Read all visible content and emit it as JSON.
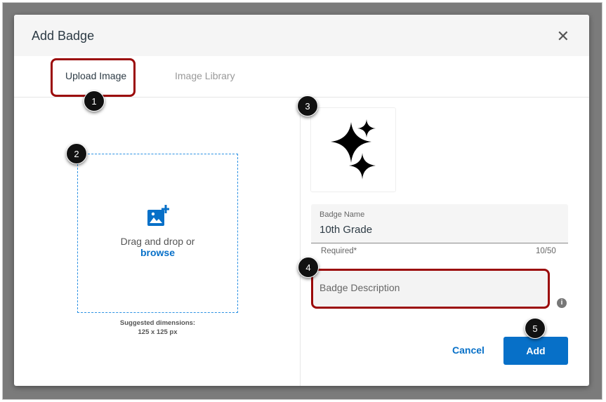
{
  "dialog": {
    "title": "Add Badge",
    "close_label": "✕"
  },
  "tabs": [
    {
      "label": "Upload Image"
    },
    {
      "label": "Image Library"
    }
  ],
  "dropzone": {
    "text": "Drag and drop or",
    "link": "browse",
    "suggested": "Suggested dimensions:",
    "dimensions": "125 x 125 px"
  },
  "badge_name": {
    "label": "Badge Name",
    "value": "10th Grade",
    "required": "Required*",
    "count": "10/50"
  },
  "badge_description": {
    "placeholder": "Badge Description"
  },
  "info_icon": "i",
  "buttons": {
    "cancel": "Cancel",
    "add": "Add"
  },
  "callouts": [
    "1",
    "2",
    "3",
    "4",
    "5"
  ],
  "colors": {
    "accent": "#0770c8",
    "highlight": "#9b0a0a"
  }
}
